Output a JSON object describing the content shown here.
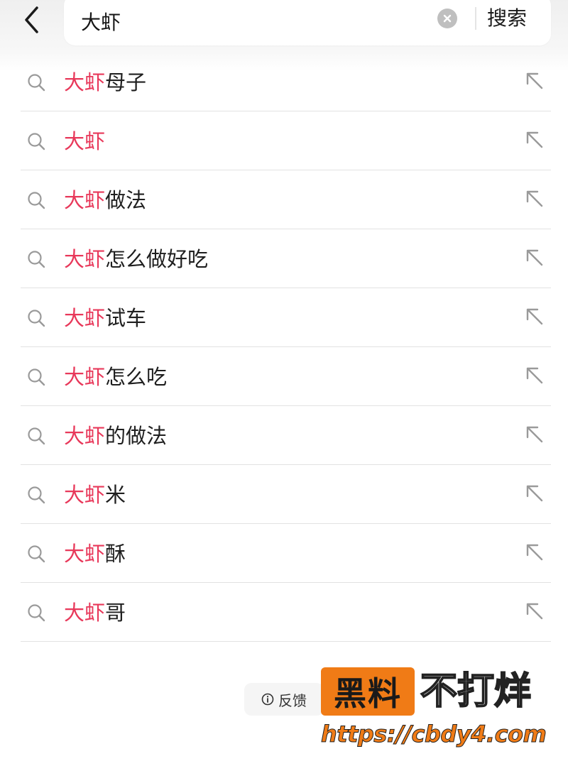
{
  "header": {
    "query_value": "大虾",
    "search_button_label": "搜索"
  },
  "suggestions": [
    {
      "highlight": "大虾",
      "rest": "母子"
    },
    {
      "highlight": "大虾",
      "rest": ""
    },
    {
      "highlight": "大虾",
      "rest": "做法"
    },
    {
      "highlight": "大虾",
      "rest": "怎么做好吃"
    },
    {
      "highlight": "大虾",
      "rest": "试车"
    },
    {
      "highlight": "大虾",
      "rest": "怎么吃"
    },
    {
      "highlight": "大虾",
      "rest": "的做法"
    },
    {
      "highlight": "大虾",
      "rest": "米"
    },
    {
      "highlight": "大虾",
      "rest": "酥"
    },
    {
      "highlight": "大虾",
      "rest": "哥"
    }
  ],
  "feedback": {
    "label": "反馈"
  },
  "watermark": {
    "brand_badge": "黑料",
    "brand_text": "不打烊",
    "url": "https://cbdy4.com"
  },
  "colors": {
    "highlight": "#e8385a",
    "divider": "#e2e2e2",
    "watermark_orange": "#f07b16"
  },
  "icons": {
    "back": "chevron-left-icon",
    "clear": "clear-circle-icon",
    "row_search": "search-icon",
    "row_fill": "arrow-up-left-icon",
    "feedback": "info-icon"
  }
}
